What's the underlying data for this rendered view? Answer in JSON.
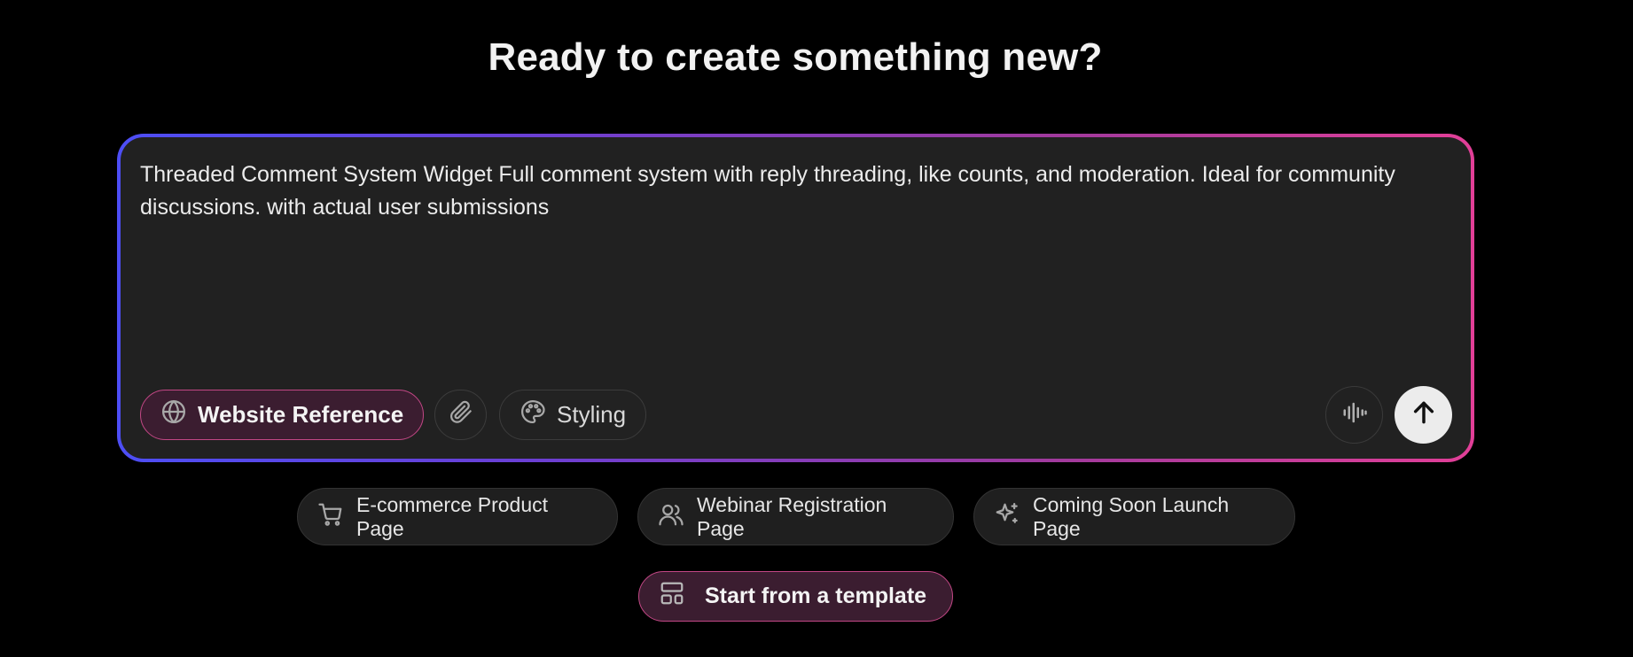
{
  "header": {
    "title": "Ready to create something new?"
  },
  "prompt": {
    "value": "Threaded Comment System Widget Full comment system with reply threading, like counts, and moderation. Ideal for community discussions. with actual user submissions",
    "gradient_colors": [
      "#4d4ef5",
      "#e23f98"
    ]
  },
  "toolbar": {
    "website_reference_label": "Website Reference",
    "website_reference_icon": "globe-icon",
    "attach_icon": "paperclip-icon",
    "styling_label": "Styling",
    "styling_icon": "palette-icon",
    "voice_icon": "audio-waveform-icon",
    "send_icon": "arrow-up-icon"
  },
  "suggestions": [
    {
      "label": "E-commerce Product Page",
      "icon": "shopping-cart-icon"
    },
    {
      "label": "Webinar Registration Page",
      "icon": "users-icon"
    },
    {
      "label": "Coming Soon Launch Page",
      "icon": "sparkles-icon"
    }
  ],
  "template": {
    "label": "Start from a template",
    "icon": "layout-template-icon"
  },
  "colors": {
    "background": "#000000",
    "prompt_bg": "#212121",
    "accent_pink": "#c24785",
    "accent_bg": "#3b1d30"
  }
}
